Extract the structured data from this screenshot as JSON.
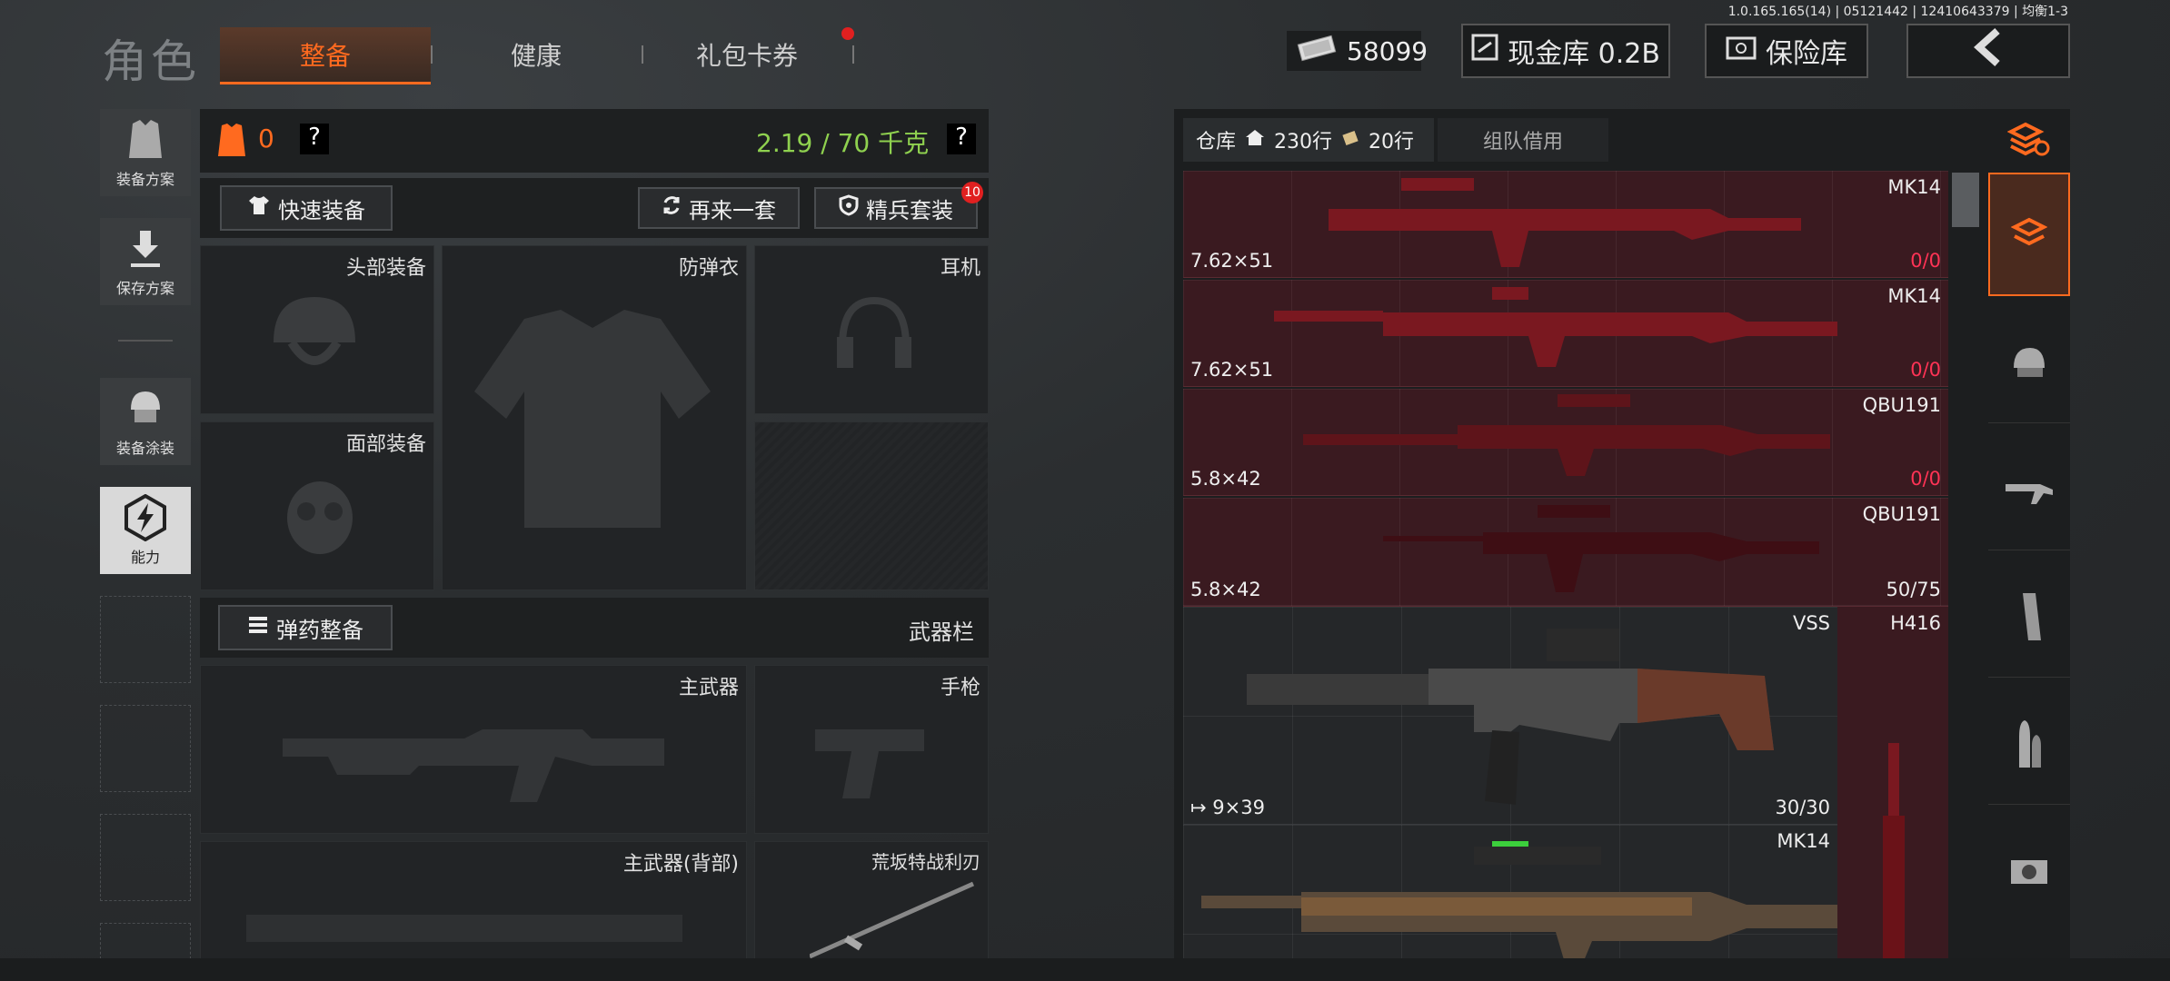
{
  "header": {
    "title": "角色",
    "tabs": [
      {
        "label": "整备",
        "active": true
      },
      {
        "label": "健康",
        "active": false
      },
      {
        "label": "礼包卡券",
        "active": false,
        "badge_dot": true
      }
    ],
    "version": "1.0.165.165(14) | 05121442 | 12410643379 | 均衡1-3",
    "currency_value": "58099",
    "cash_vault_label": "现金库 0.2B",
    "safe_label": "保险库",
    "back_icon": "chevron-left-icon"
  },
  "left_menu": [
    {
      "label": "装备方案",
      "icon": "vest-icon",
      "active": false
    },
    {
      "label": "保存方案",
      "icon": "download-icon",
      "active": false
    },
    {
      "label": "装备涂装",
      "icon": "helmet-paint-icon",
      "active": false
    },
    {
      "label": "能力",
      "icon": "lightning-hex-icon",
      "active": true
    }
  ],
  "loadout": {
    "armor_count": "0",
    "help_mark": "?",
    "weight": "2.19 / 70 千克",
    "quick_equip_label": "快速装备",
    "again_label": "再来一套",
    "elite_label": "精兵套装",
    "elite_badge": "10",
    "slots": {
      "head": "头部装备",
      "armor": "防弹衣",
      "headset": "耳机",
      "face": "面部装备"
    },
    "ammo_equip_label": "弹药整备",
    "weapon_bar_label": "武器栏",
    "weapon_slots": {
      "primary": "主武器",
      "pistol": "手枪",
      "primary_back": "主武器(背部)",
      "melee": "荒坂特战利刃"
    }
  },
  "inventory": {
    "warehouse_label": "仓库",
    "rows_label": "230行",
    "extra_rows_label": "20行",
    "team_borrow_label": "组队借用",
    "items": [
      {
        "name": "MK14",
        "caliber": "7.62×51",
        "ammo": "0/0",
        "ammo_red": true
      },
      {
        "name": "MK14",
        "caliber": "7.62×51",
        "ammo": "0/0",
        "ammo_red": true
      },
      {
        "name": "QBU191",
        "caliber": "5.8×42",
        "ammo": "0/0",
        "ammo_red": true
      },
      {
        "name": "QBU191",
        "caliber": "5.8×42",
        "ammo": "50/75",
        "ammo_red": false
      }
    ],
    "vss": {
      "name": "VSS",
      "caliber": "9×39",
      "ammo": "30/30"
    },
    "h416": {
      "name": "H416"
    },
    "mk14_tan": {
      "name": "MK14"
    }
  },
  "right_bar": [
    "swap-stack-icon",
    "stack-icon",
    "helmet-icon",
    "rifle-icon",
    "magazine-icon",
    "bullets-icon",
    "sight-icon"
  ],
  "colors": {
    "accent": "#ff6a1f",
    "weight_green": "#8fd14f",
    "ammo_red": "#ff3355",
    "row_red": "#3a1a20"
  }
}
